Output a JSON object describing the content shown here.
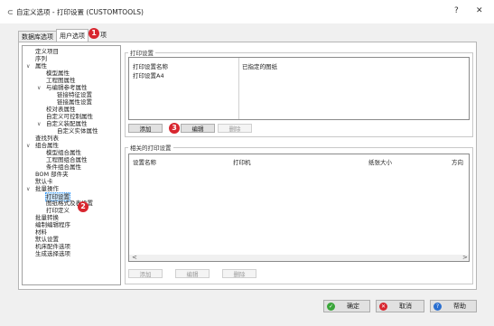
{
  "window": {
    "title": "自定义选项 - 打印设置 (CUSTOMTOOLS)",
    "help_btn": "?",
    "close_btn": "✕"
  },
  "tabs": [
    {
      "label": "数据库选项"
    },
    {
      "label": "用户选项"
    }
  ],
  "callouts": {
    "one": "1",
    "two": "2",
    "three": "3"
  },
  "tree": {
    "items": [
      {
        "label": "定义项目"
      },
      {
        "label": "序列"
      },
      {
        "label": "属性"
      },
      {
        "label": "模型属性"
      },
      {
        "label": "工程图属性"
      },
      {
        "label": "与编辑参考属性"
      },
      {
        "label": "链接特征设置"
      },
      {
        "label": "链接属性设置"
      },
      {
        "label": "校对表属性"
      },
      {
        "label": "自定义可控制属性"
      },
      {
        "label": "自定义装配属性"
      },
      {
        "label": "自定义实体属性"
      },
      {
        "label": "查找列表"
      },
      {
        "label": "组合属性"
      },
      {
        "label": "模型组合属性"
      },
      {
        "label": "工程图组合属性"
      },
      {
        "label": "条件组合属性"
      },
      {
        "label": "BOM 部件夹"
      },
      {
        "label": "默认卡"
      },
      {
        "label": "批量操作"
      },
      {
        "label": "打印设置"
      },
      {
        "label": "图纸格式及表设置"
      },
      {
        "label": "打印定义"
      },
      {
        "label": "批量转换"
      },
      {
        "label": "编制编辑程序"
      },
      {
        "label": "材料"
      },
      {
        "label": "默认设置"
      },
      {
        "label": "机床配件选项"
      },
      {
        "label": "生成选择选项"
      }
    ]
  },
  "print_settings": {
    "group_title": "打印设置",
    "col_name": "打印设置名称",
    "col_drawing": "已指定的图纸",
    "rows": [
      {
        "name": "打印设置A4",
        "drawing": ""
      }
    ],
    "add_btn": "添加",
    "edit_btn": "编辑",
    "delete_btn": "删除"
  },
  "printer_settings": {
    "group_title": "相关的打印设置",
    "col_setting": "设置名称",
    "col_printer": "打印机",
    "col_paper": "纸张大小",
    "col_cut": "方向",
    "add_btn": "添加",
    "edit_btn": "编辑",
    "delete_btn": "删除",
    "scroll_left": "<",
    "scroll_right": ">"
  },
  "footer": {
    "ok": "确定",
    "cancel": "取消",
    "help": "帮助"
  },
  "colors": {
    "callout": "#d8262f",
    "ok_icon": "#3aa63a",
    "cancel_icon": "#d8262f",
    "help_icon": "#2a6fd0"
  }
}
